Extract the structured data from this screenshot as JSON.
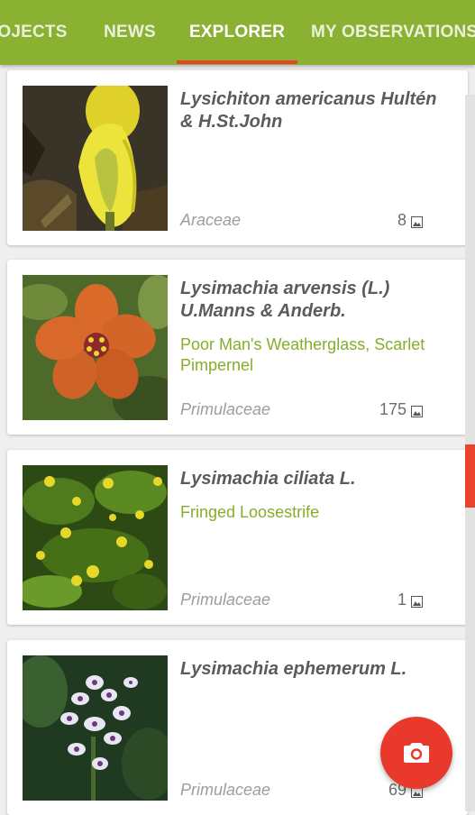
{
  "tabs": [
    {
      "label": "OJECTS",
      "active": false
    },
    {
      "label": "NEWS",
      "active": false
    },
    {
      "label": "EXPLORER",
      "active": true
    },
    {
      "label": "MY OBSERVATIONS",
      "active": false
    }
  ],
  "species": [
    {
      "scientific_name": "Lysichiton americanus Hultén & H.St.John",
      "common_name": "",
      "family": "Araceae",
      "observation_count": "8",
      "thumbnail_icon": "yellow-skunk-cabbage-photo"
    },
    {
      "scientific_name": "Lysimachia arvensis (L.) U.Manns & Anderb.",
      "common_name": "Poor Man's Weatherglass, Scarlet Pimpernel",
      "family": "Primulaceae",
      "observation_count": "175",
      "thumbnail_icon": "orange-pimpernel-flower-photo"
    },
    {
      "scientific_name": "Lysimachia ciliata L.",
      "common_name": "Fringed Loosestrife",
      "family": "Primulaceae",
      "observation_count": "1",
      "thumbnail_icon": "yellow-loosestrife-photo"
    },
    {
      "scientific_name": "Lysimachia ephemerum L.",
      "common_name": "",
      "family": "Primulaceae",
      "observation_count": "69",
      "thumbnail_icon": "white-purple-flowers-photo"
    }
  ],
  "fab": {
    "icon": "camera-icon"
  },
  "colors": {
    "app_bar": "#8ab132",
    "accent": "#e8432c",
    "common_name_text": "#87ad2c"
  }
}
